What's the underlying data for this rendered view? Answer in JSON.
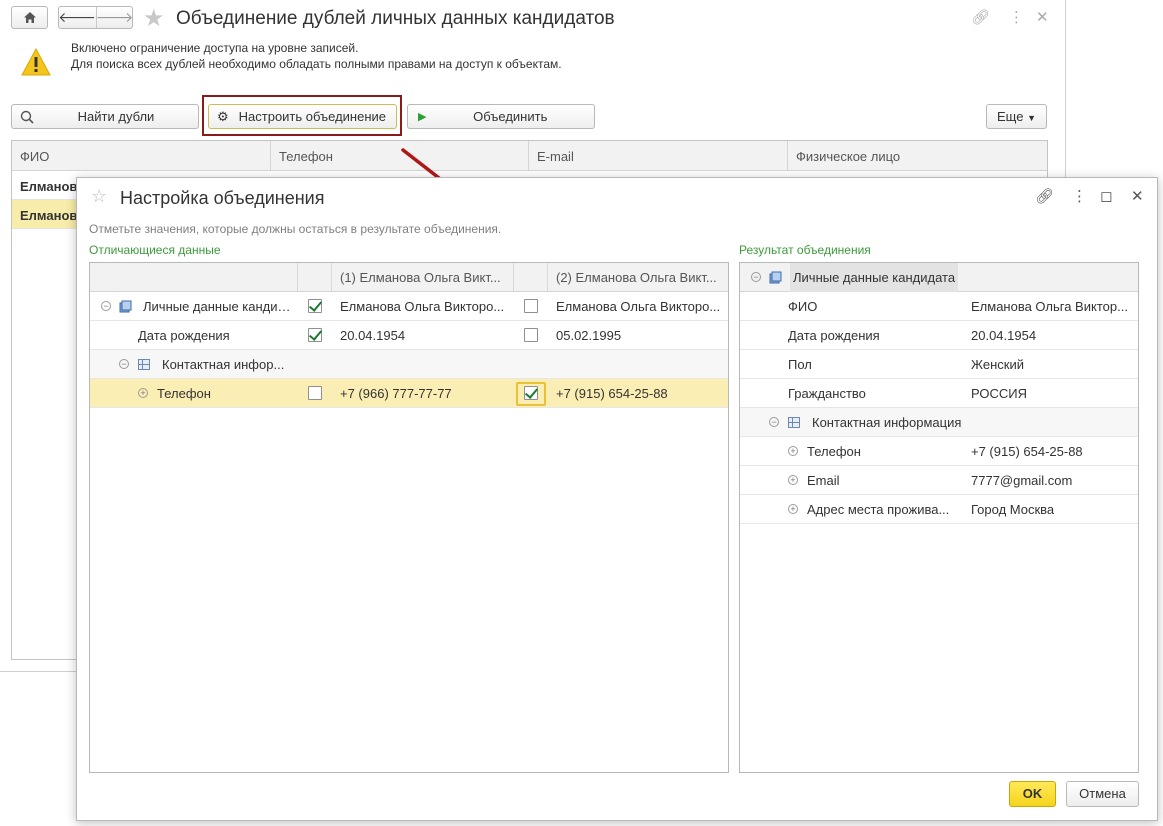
{
  "main": {
    "title": "Объединение дублей личных данных кандидатов",
    "warning": {
      "line1": "Включено ограничение доступа на уровне записей.",
      "line2": "Для поиска всех дублей необходимо обладать полными правами на доступ к объектам."
    },
    "toolbar": {
      "find": "Найти дубли",
      "setup": "Настроить объединение",
      "merge": "Объединить",
      "more": "Еще"
    },
    "columns": [
      "ФИО",
      "Телефон",
      "E-mail",
      "Физическое лицо"
    ],
    "rows": [
      "Елманова",
      "Елманова"
    ]
  },
  "dialog": {
    "title": "Настройка объединения",
    "hint": "Отметьте значения, которые должны остаться в результате объединения.",
    "left_label": "Отличающиеся данные",
    "right_label": "Результат объединения",
    "left_grid": {
      "col1": "(1) Елманова Ольга Викт...",
      "col2": "(2) Елманова Ольга Викт...",
      "rows": [
        {
          "name": "Личные данные кандид...",
          "v1": "Елманова Ольга Викторо...",
          "v1_checked": true,
          "v2": "Елманова Ольга Викторо...",
          "v2_checked": false
        },
        {
          "name": "Дата рождения",
          "v1": "20.04.1954",
          "v1_checked": true,
          "v2": "05.02.1995",
          "v2_checked": false
        },
        {
          "name": "Контактная инфор...",
          "v1": "",
          "v2": ""
        },
        {
          "name": "Телефон",
          "v1": "+7 (966) 777-77-77",
          "v1_checked": false,
          "v2": "+7 (915) 654-25-88",
          "v2_checked": true
        }
      ]
    },
    "right_grid": {
      "root": "Личные данные кандидата",
      "rows": [
        {
          "name": "ФИО",
          "value": "Елманова Ольга Виктор..."
        },
        {
          "name": "Дата рождения",
          "value": "20.04.1954"
        },
        {
          "name": "Пол",
          "value": "Женский"
        },
        {
          "name": "Гражданство",
          "value": "РОССИЯ"
        },
        {
          "name": "Контактная информация",
          "value": ""
        },
        {
          "name": "Телефон",
          "value": "+7 (915) 654-25-88"
        },
        {
          "name": "Email",
          "value": "7777@gmail.com"
        },
        {
          "name": "Адрес места прожива...",
          "value": "Город Москва"
        }
      ]
    },
    "ok": "OK",
    "cancel": "Отмена"
  },
  "colors": {
    "accent_green": "#3c9a3c",
    "selected_row": "#fbeeb4",
    "ok_button": "#f5d41c",
    "highlight_border": "#8b1a1a",
    "arrow": "#b01818"
  }
}
